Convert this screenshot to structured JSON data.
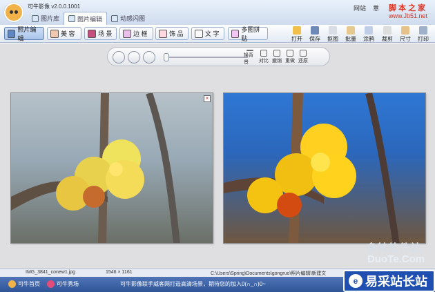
{
  "titlebar": {
    "title": "可牛影像 v2.0.0.1001",
    "tabs": [
      {
        "label": "图片库"
      },
      {
        "label": "图片编辑"
      },
      {
        "label": "动感闪图"
      }
    ],
    "links": [
      "网站",
      "意"
    ]
  },
  "toolbar": {
    "tools": [
      {
        "label": "照片编辑"
      },
      {
        "label": "美 容"
      },
      {
        "label": "场 景"
      },
      {
        "label": "边 框"
      },
      {
        "label": "饰 品"
      },
      {
        "label": "文 字"
      },
      {
        "label": "多图拼贴"
      }
    ],
    "actions": [
      "打开",
      "保存",
      "抠图",
      "批量",
      "涂鸦",
      "裁剪",
      "尺寸",
      "打印"
    ]
  },
  "viewer": {
    "mini_buttons": [
      "换背景",
      "对比",
      "撤销",
      "重做",
      "还原"
    ]
  },
  "status": {
    "filename": "IMG_3841_conew1.jpg",
    "dimensions": "1546 × 1161",
    "path": "C:\\Users\\Spring\\Documents\\gongruo\\照片编辑\\新建文"
  },
  "footer": {
    "links": [
      "可牛首页",
      "可牛秀场"
    ],
    "message": "可牛影像联手威客网打造高清场景，期待您的加入0(∩_∩)0~"
  },
  "overlay": {
    "watermark_top": "脚 本 之 家",
    "watermark_url": "www.Jb51.net",
    "badge": "易采站长站",
    "watermark_duo": "多特软件站",
    "watermark_site": "DuoTe.Com"
  }
}
